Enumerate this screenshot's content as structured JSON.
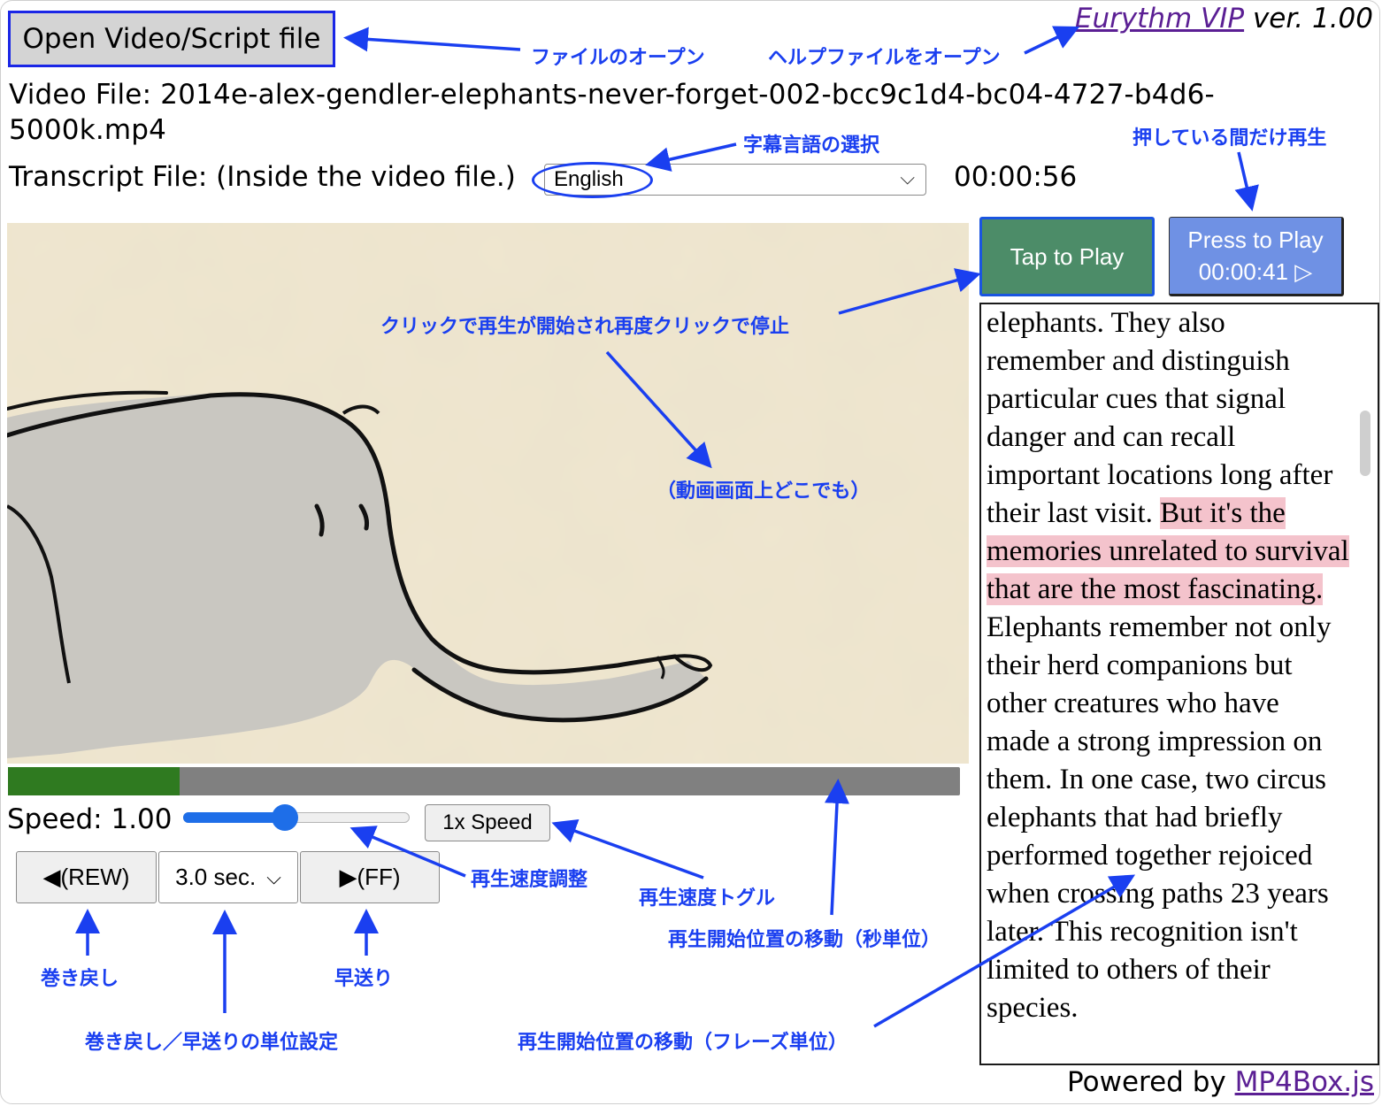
{
  "header": {
    "open_button_label": "Open Video/Script file",
    "app_name": "Eurythm VIP",
    "version_text": " ver. 1.00"
  },
  "file_info": {
    "video_file_text": "Video File: 2014e-alex-gendler-elephants-never-forget-002-bcc9c1d4-bc04-4727-b4d6-5000k.mp4",
    "transcript_file_text": "Transcript File: (Inside the video file.)",
    "language_selected": "English",
    "current_time": "00:00:56"
  },
  "player": {
    "progress_fraction": 0.18,
    "speed_label": "Speed: 1.00",
    "speed_slider_fraction": 0.45,
    "speed_toggle_label": "1x Speed",
    "rew_label": "◀(REW)",
    "step_value": "3.0 sec.",
    "ff_label": "▶(FF)"
  },
  "play_buttons": {
    "tap_label": "Tap to Play",
    "press_label": "Press to Play",
    "press_time": "00:00:41 ▷"
  },
  "transcript": {
    "before": "elephants. They also remember and distinguish particular cues that signal danger and can recall important locations long after their last visit. ",
    "highlight": "But it's the memories unrelated to survival that are the most fascinating.",
    "after": " Elephants remember not only their herd companions but other creatures who have made a strong impression on them. In one case, two circus elephants that had briefly performed together rejoiced when crossing paths 23 years later. This recognition isn't limited to others of their species."
  },
  "footer": {
    "powered_by": "Powered by ",
    "library_link": "MP4Box.js"
  },
  "annotations": {
    "open_file": "ファイルのオープン",
    "open_help": "ヘルプファイルをオープン",
    "subtitle_language": "字幕言語の選択",
    "press_hold": "押している間だけ再生",
    "click_play": "クリックで再生が開始され再度クリックで停止",
    "anywhere": "（動画画面上どこでも）",
    "speed_adjust": "再生速度調整",
    "speed_toggle": "再生速度トグル",
    "seek_seconds": "再生開始位置の移動（秒単位）",
    "rewind": "巻き戻し",
    "fast_forward": "早送り",
    "step_unit": "巻き戻し／早送りの単位設定",
    "seek_phrase": "再生開始位置の移動（フレーズ単位）"
  },
  "colors": {
    "annotation_blue": "#1a3ff0",
    "progress_green": "#2f7a20",
    "tap_button_green": "#4c8c68",
    "press_button_blue": "#6f91e4",
    "highlight_pink": "#f4c3cc",
    "link_purple": "#5b1f94"
  }
}
